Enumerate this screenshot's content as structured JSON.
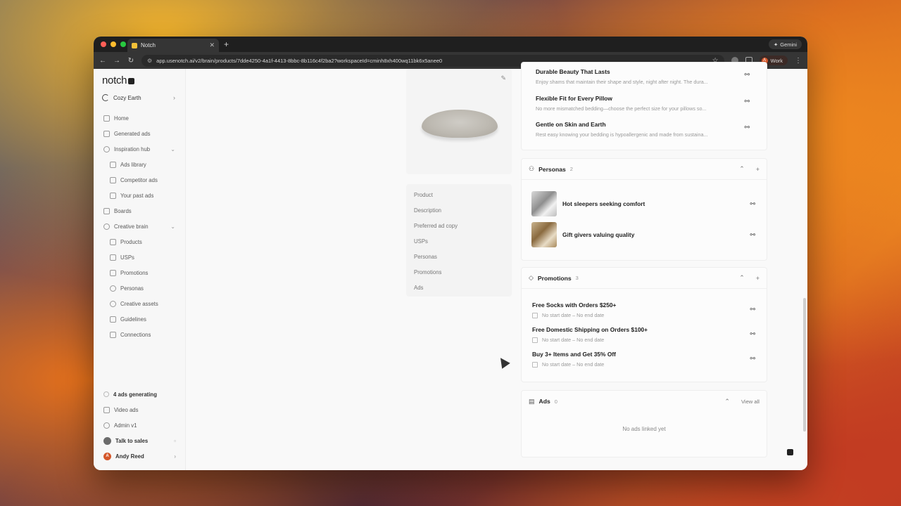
{
  "browser": {
    "tab_title": "Notch",
    "url": "app.usenotch.ai/v2/brain/products/7dde4250-4a1f-4413-8bbc-8b116c4f2ba2?workspaceId=cminh8xh400wq11bk6x5anee0",
    "gemini_label": "Gemini",
    "profile_label": "Work",
    "profile_initial": "A"
  },
  "sidebar": {
    "logo": "notch",
    "workspace": "Cozy Earth",
    "items": [
      {
        "label": "Home"
      },
      {
        "label": "Generated ads"
      },
      {
        "label": "Inspiration hub"
      },
      {
        "label": "Ads library"
      },
      {
        "label": "Competitor ads"
      },
      {
        "label": "Your past ads"
      },
      {
        "label": "Boards"
      },
      {
        "label": "Creative brain"
      },
      {
        "label": "Products"
      },
      {
        "label": "USPs"
      },
      {
        "label": "Promotions"
      },
      {
        "label": "Personas"
      },
      {
        "label": "Creative assets"
      },
      {
        "label": "Guidelines"
      },
      {
        "label": "Connections"
      }
    ],
    "bottom": {
      "generating": "4 ads generating",
      "video_ads": "Video ads",
      "admin": "Admin v1",
      "talk_to_sales": "Talk to sales",
      "user_name": "Andy Reed",
      "user_initial": "A"
    }
  },
  "section_nav": [
    "Product",
    "Description",
    "Preferred ad copy",
    "USPs",
    "Personas",
    "Promotions",
    "Ads"
  ],
  "usps": [
    {
      "title": "Durable Beauty That Lasts",
      "desc": "Enjoy shams that maintain their shape and style, night after night. The dura..."
    },
    {
      "title": "Flexible Fit for Every Pillow",
      "desc": "No more mismatched bedding—choose the perfect size for your pillows so..."
    },
    {
      "title": "Gentle on Skin and Earth",
      "desc": "Rest easy knowing your bedding is hypoallergenic and made from sustaina..."
    }
  ],
  "personas": {
    "title": "Personas",
    "count": "2",
    "items": [
      {
        "name": "Hot sleepers seeking comfort"
      },
      {
        "name": "Gift givers valuing quality"
      }
    ]
  },
  "promotions": {
    "title": "Promotions",
    "count": "3",
    "items": [
      {
        "title": "Free Socks with Orders $250+",
        "dates": "No start date – No end date"
      },
      {
        "title": "Free Domestic Shipping on Orders $100+",
        "dates": "No start date – No end date"
      },
      {
        "title": "Buy 3+ Items and Get 35% Off",
        "dates": "No start date – No end date"
      }
    ]
  },
  "ads": {
    "title": "Ads",
    "count": "0",
    "view_all": "View all",
    "empty": "No ads linked yet"
  }
}
